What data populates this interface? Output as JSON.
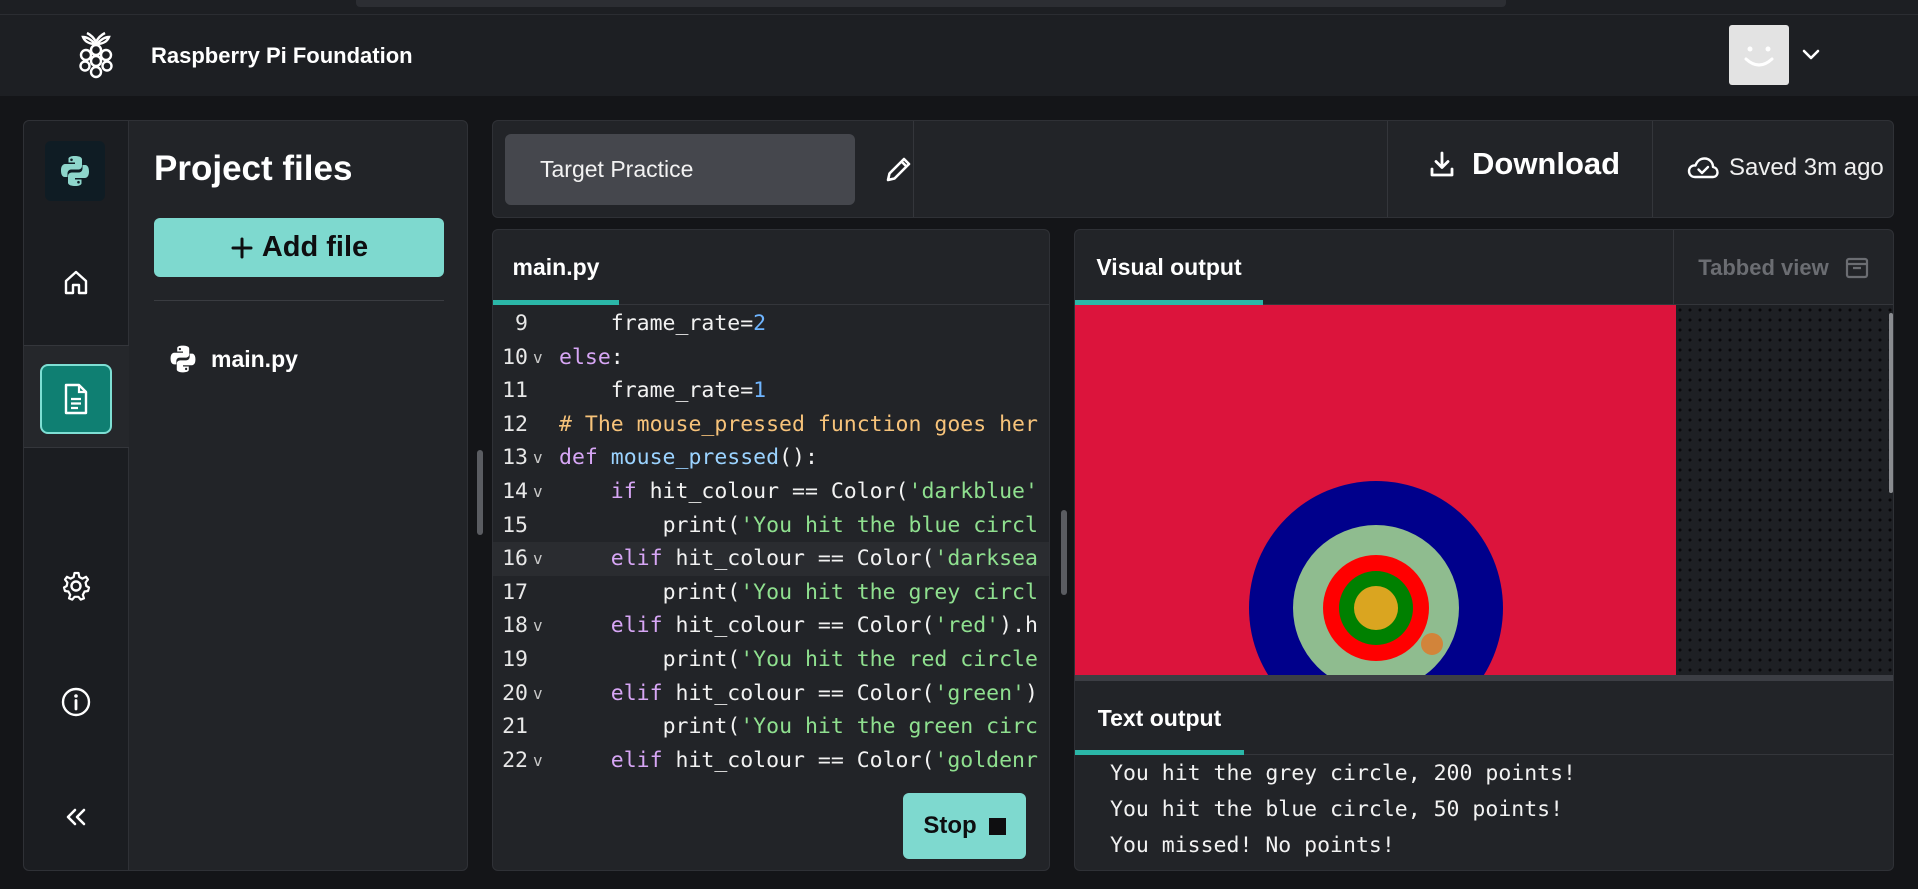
{
  "header": {
    "brand": "Raspberry Pi Foundation"
  },
  "sidebar": {
    "rail_items": [
      {
        "icon": "python-logo-icon"
      },
      {
        "icon": "home-icon"
      },
      {
        "icon": "file-icon",
        "active": true
      },
      {
        "icon": "gear-icon"
      },
      {
        "icon": "info-icon"
      },
      {
        "icon": "collapse-icon"
      }
    ],
    "title": "Project files",
    "add_file_label": "Add file",
    "files": [
      {
        "name": "main.py",
        "icon": "python-file-icon"
      }
    ]
  },
  "project_bar": {
    "project_name": "Target Practice",
    "download_label": "Download",
    "saved_text": "Saved 3m ago"
  },
  "editor": {
    "tab_label": "main.py",
    "lines": [
      {
        "n": "9",
        "fold": false,
        "indent": "    ",
        "parts": [
          {
            "t": "frame_rate=",
            "c": ""
          },
          {
            "t": "2",
            "c": "num"
          }
        ]
      },
      {
        "n": "10",
        "fold": true,
        "indent": "",
        "parts": [
          {
            "t": "else",
            "c": "kw"
          },
          {
            "t": ":",
            "c": ""
          }
        ]
      },
      {
        "n": "11",
        "fold": false,
        "indent": "    ",
        "parts": [
          {
            "t": "frame_rate=",
            "c": ""
          },
          {
            "t": "1",
            "c": "num"
          }
        ]
      },
      {
        "n": "12",
        "fold": false,
        "indent": "",
        "parts": [
          {
            "t": "# The mouse_pressed function goes her",
            "c": "cm"
          }
        ]
      },
      {
        "n": "13",
        "fold": true,
        "indent": "",
        "parts": [
          {
            "t": "def ",
            "c": "kw"
          },
          {
            "t": "mouse_pressed",
            "c": "fn"
          },
          {
            "t": "():",
            "c": ""
          }
        ]
      },
      {
        "n": "14",
        "fold": true,
        "indent": "    ",
        "parts": [
          {
            "t": "if",
            "c": "kw"
          },
          {
            "t": " hit_colour == Color(",
            "c": ""
          },
          {
            "t": "'darkblue'",
            "c": "str"
          }
        ]
      },
      {
        "n": "15",
        "fold": false,
        "indent": "        ",
        "parts": [
          {
            "t": "print(",
            "c": ""
          },
          {
            "t": "'You hit the blue circl",
            "c": "str"
          }
        ]
      },
      {
        "n": "16",
        "fold": true,
        "indent": "    ",
        "hl": true,
        "parts": [
          {
            "t": "elif",
            "c": "kw"
          },
          {
            "t": " hit_colour == Color(",
            "c": ""
          },
          {
            "t": "'darksea",
            "c": "str"
          }
        ]
      },
      {
        "n": "17",
        "fold": false,
        "indent": "        ",
        "parts": [
          {
            "t": "print(",
            "c": ""
          },
          {
            "t": "'You hit the grey circl",
            "c": "str"
          }
        ]
      },
      {
        "n": "18",
        "fold": true,
        "indent": "    ",
        "parts": [
          {
            "t": "elif",
            "c": "kw"
          },
          {
            "t": " hit_colour == Color(",
            "c": ""
          },
          {
            "t": "'red'",
            "c": "str"
          },
          {
            "t": ").h",
            "c": ""
          }
        ]
      },
      {
        "n": "19",
        "fold": false,
        "indent": "        ",
        "parts": [
          {
            "t": "print(",
            "c": ""
          },
          {
            "t": "'You hit the red circle",
            "c": "str"
          }
        ]
      },
      {
        "n": "20",
        "fold": true,
        "indent": "    ",
        "parts": [
          {
            "t": "elif",
            "c": "kw"
          },
          {
            "t": " hit_colour == Color(",
            "c": ""
          },
          {
            "t": "'green'",
            "c": "str"
          },
          {
            "t": ")",
            "c": ""
          }
        ]
      },
      {
        "n": "21",
        "fold": false,
        "indent": "        ",
        "parts": [
          {
            "t": "print(",
            "c": ""
          },
          {
            "t": "'You hit the green circ",
            "c": "str"
          }
        ]
      },
      {
        "n": "22",
        "fold": true,
        "indent": "    ",
        "parts": [
          {
            "t": "elif",
            "c": "kw"
          },
          {
            "t": " hit_colour == Color(",
            "c": ""
          },
          {
            "t": "'goldenr",
            "c": "str"
          }
        ]
      }
    ],
    "fold_glyph": "v",
    "stop_label": "Stop"
  },
  "output": {
    "visual_tab_label": "Visual output",
    "tabbed_view_label": "Tabbed view",
    "text_tab_label": "Text output",
    "text_lines": [
      "You hit the grey circle, 200 points!",
      "You hit the blue circle, 50 points!",
      "You missed! No points!"
    ],
    "target_colors": {
      "background": "#dc143c",
      "ring_outer": "#00008b",
      "ring_grey": "#8fbc8f",
      "ring_red": "#ff0000",
      "ring_green": "#008000",
      "bullseye": "#daa520",
      "arrow": "#d2843a"
    }
  },
  "colors": {
    "accent": "#7ed9cf",
    "tab_underline": "#2bb7a8",
    "active_rail": "#0f7f72"
  }
}
